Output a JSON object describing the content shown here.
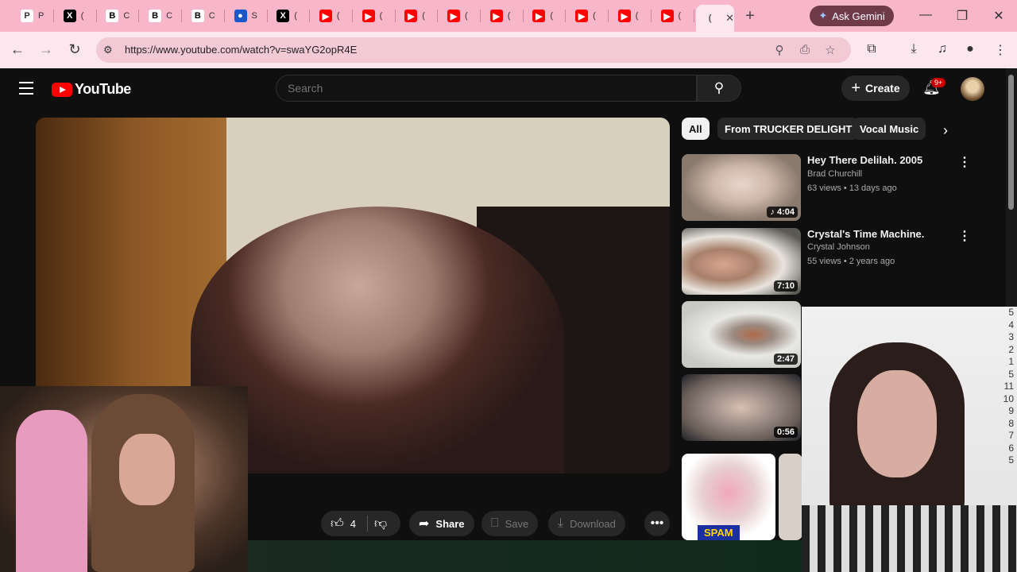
{
  "browser": {
    "tabs": [
      {
        "label": "P",
        "favicon": "P",
        "color": "#ffffff",
        "fg": "#333"
      },
      {
        "label": "(",
        "favicon": "X",
        "color": "#000000",
        "fg": "#fff"
      },
      {
        "label": "C",
        "favicon": "B",
        "color": "#ffffff",
        "fg": "#000"
      },
      {
        "label": "C",
        "favicon": "B",
        "color": "#ffffff",
        "fg": "#000"
      },
      {
        "label": "C",
        "favicon": "B",
        "color": "#ffffff",
        "fg": "#000"
      },
      {
        "label": "S",
        "favicon": "●",
        "color": "#1a57c8",
        "fg": "#fff"
      },
      {
        "label": "(",
        "favicon": "X",
        "color": "#000000",
        "fg": "#fff"
      },
      {
        "label": "(",
        "favicon": "▶",
        "color": "#ff0000",
        "fg": "#fff"
      },
      {
        "label": "(",
        "favicon": "▶",
        "color": "#ff0000",
        "fg": "#fff"
      },
      {
        "label": "(",
        "favicon": "▶",
        "color": "#ff0000",
        "fg": "#fff"
      },
      {
        "label": "(",
        "favicon": "▶",
        "color": "#ff0000",
        "fg": "#fff"
      },
      {
        "label": "(",
        "favicon": "▶",
        "color": "#ff0000",
        "fg": "#fff"
      },
      {
        "label": "(",
        "favicon": "▶",
        "color": "#ff0000",
        "fg": "#fff"
      },
      {
        "label": "(",
        "favicon": "▶",
        "color": "#ff0000",
        "fg": "#fff"
      },
      {
        "label": "(",
        "favicon": "▶",
        "color": "#ff0000",
        "fg": "#fff"
      },
      {
        "label": "(",
        "favicon": "▶",
        "color": "#ff0000",
        "fg": "#fff"
      }
    ],
    "active_tab": {
      "label": "(",
      "close": "✕"
    },
    "new_tab": "+",
    "gemini_label": "Ask Gemini",
    "url": "https://www.youtube.com/watch?v=swaYG2opR4E"
  },
  "youtube": {
    "logo_text": "YouTube",
    "search_placeholder": "Search",
    "create_label": "Create",
    "notification_badge": "9+",
    "chips": [
      "All",
      "From TRUCKER DELIGHT",
      "Vocal Music"
    ],
    "actions": {
      "like_count": "4",
      "share_label": "Share",
      "save_label": "Save",
      "download_label": "Download"
    },
    "recommendations": [
      {
        "title": "Hey There Delilah.  2005",
        "channel": "Brad Churchill",
        "meta": "63 views • 13 days ago",
        "duration": "♪ 4:04"
      },
      {
        "title": "Crystal's Time Machine.",
        "channel": "Crystal Johnson",
        "meta": "55 views • 2 years ago",
        "duration": "7:10"
      },
      {
        "duration": "2:47"
      },
      {
        "duration": "0:56"
      }
    ],
    "shorts_label": "SPAM"
  },
  "overlay": {
    "ruler": [
      "5",
      "4",
      "3",
      "2",
      "1",
      "5",
      "11",
      "10",
      "9",
      "8",
      "7",
      "6",
      "5"
    ]
  }
}
